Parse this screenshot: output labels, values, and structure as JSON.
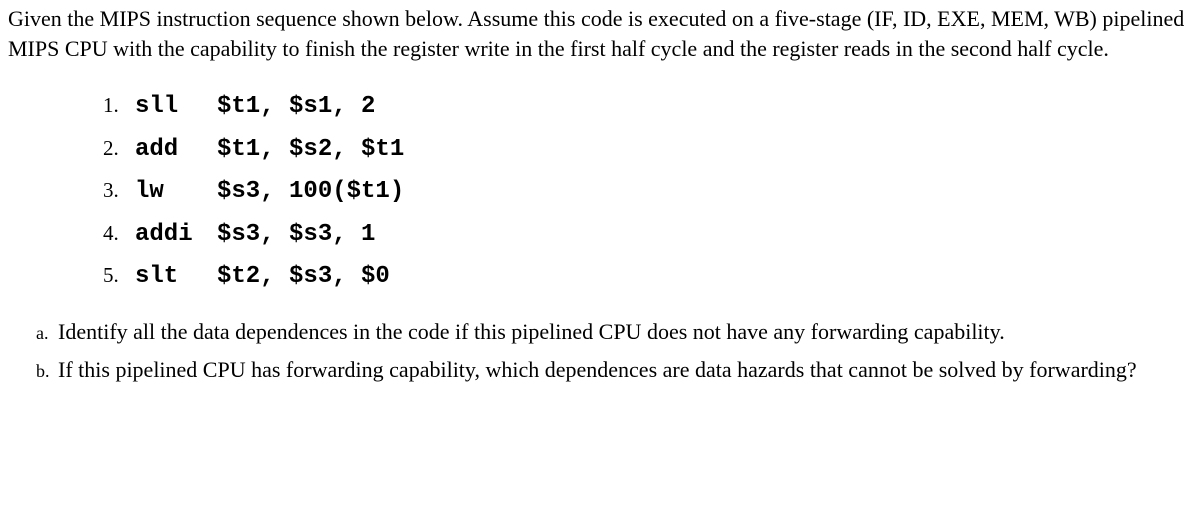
{
  "intro": "Given the MIPS instruction sequence shown below. Assume this code is executed on a five-stage (IF, ID, EXE, MEM, WB) pipelined MIPS CPU with the capability to finish the register write in the first half cycle and the register reads in the second half cycle.",
  "code": {
    "line1": {
      "num": "1.",
      "op": "sll",
      "args": "$t1, $s1, 2"
    },
    "line2": {
      "num": "2.",
      "op": "add",
      "args": "$t1, $s2, $t1"
    },
    "line3": {
      "num": "3.",
      "op": "lw",
      "args": "$s3, 100($t1)"
    },
    "line4": {
      "num": "4.",
      "op": "addi",
      "args": "$s3, $s3, 1"
    },
    "line5": {
      "num": "5.",
      "op": "slt",
      "args": "$t2, $s3, $0"
    }
  },
  "questions": {
    "a": {
      "letter": "a.",
      "text": "Identify all the data dependences in the code if this pipelined CPU does not have any forwarding capability."
    },
    "b": {
      "letter": "b.",
      "text": "If this pipelined CPU has forwarding capability, which dependences are data hazards that cannot be solved by forwarding?"
    }
  }
}
